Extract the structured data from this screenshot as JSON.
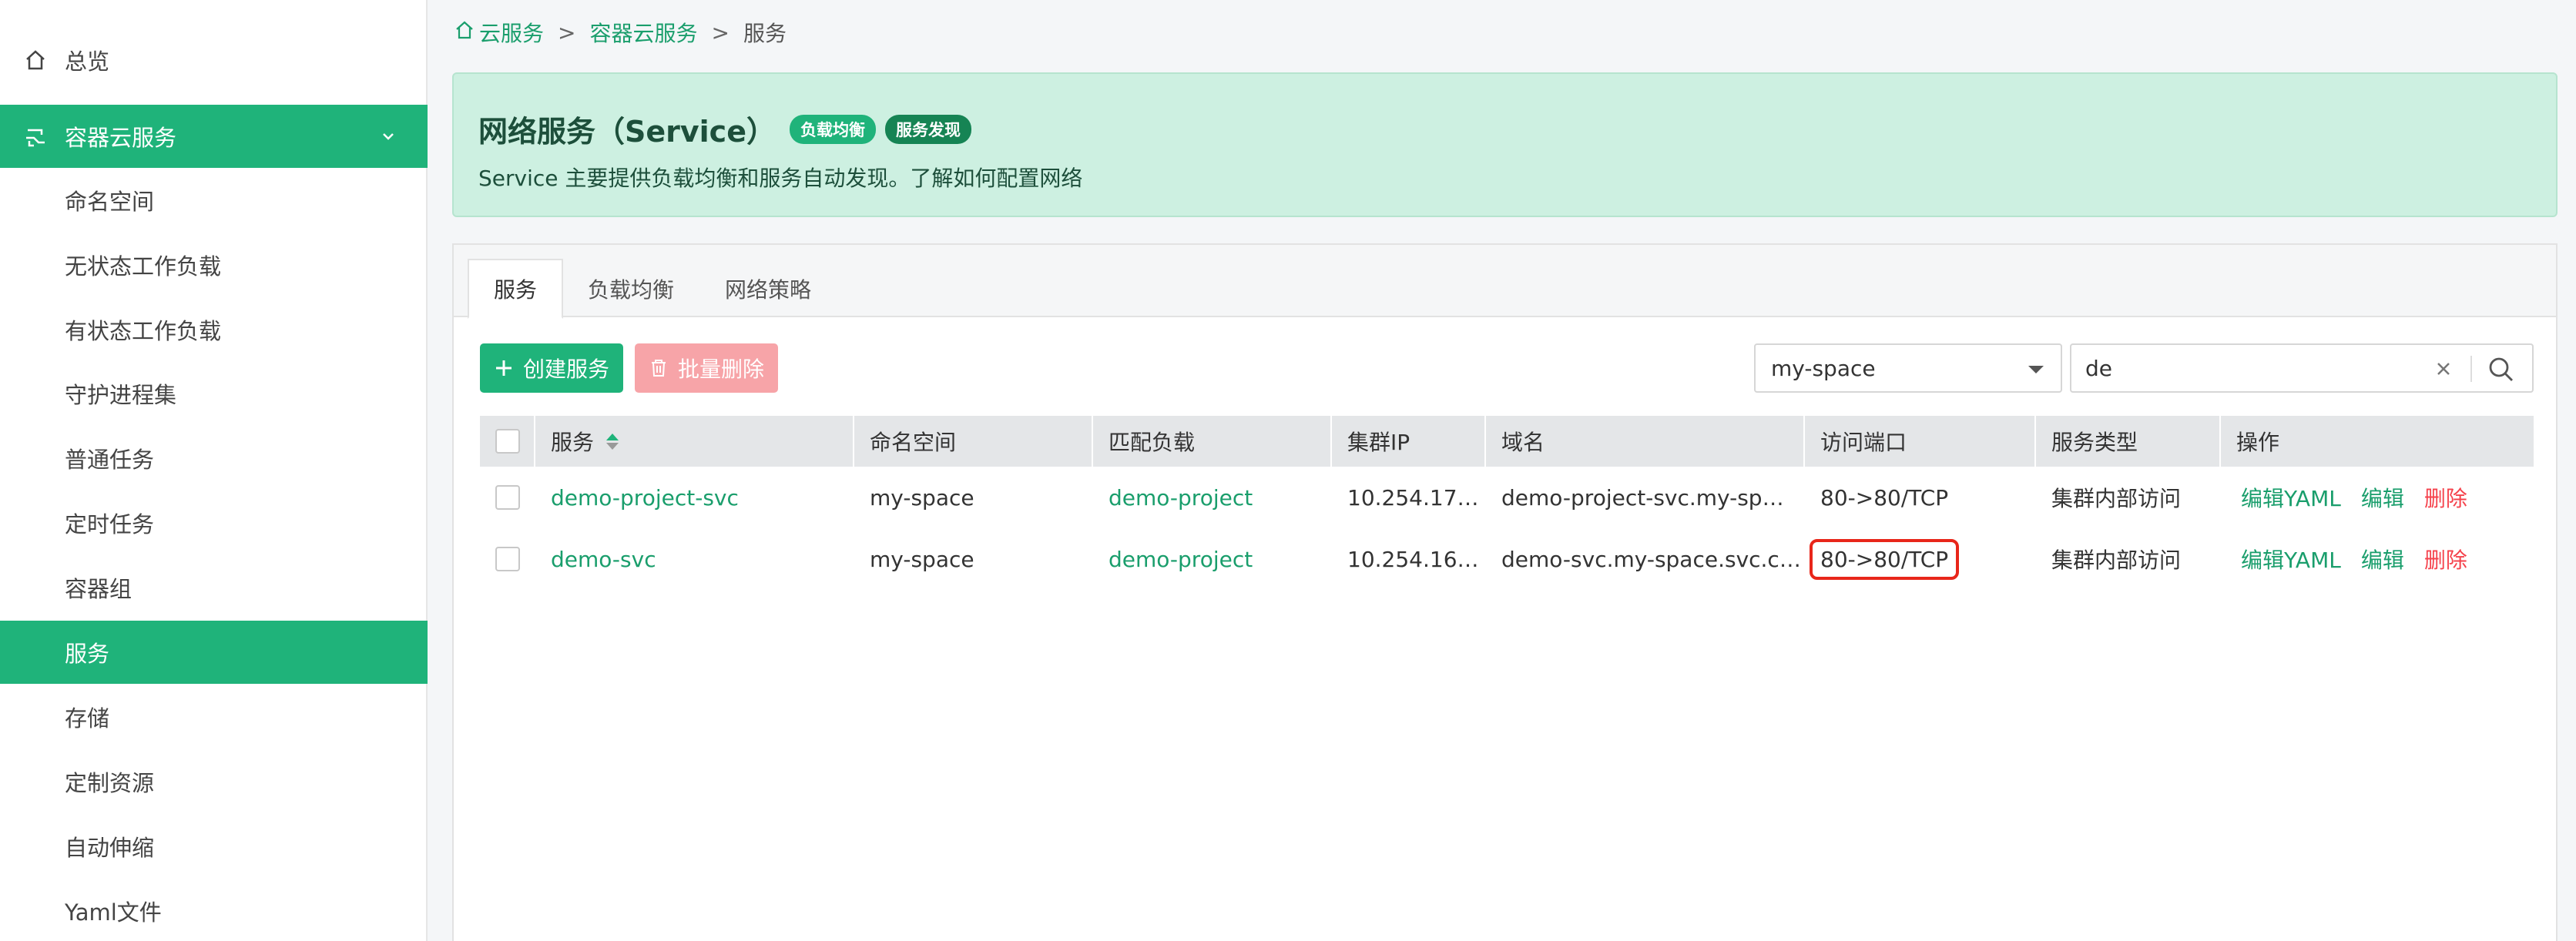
{
  "sidebar": {
    "overview": "总览",
    "group": "容器云服务",
    "items": [
      "命名空间",
      "无状态工作负载",
      "有状态工作负载",
      "守护进程集",
      "普通任务",
      "定时任务",
      "容器组",
      "服务",
      "存储",
      "定制资源",
      "自动伸缩",
      "Yaml文件"
    ],
    "active": "服务"
  },
  "breadcrumb": {
    "home": "云服务",
    "sep1": ">",
    "group": "容器云服务",
    "sep2": ">",
    "current": "服务"
  },
  "banner": {
    "title": "网络服务（Service）",
    "tag1": "负载均衡",
    "tag2": "服务发现",
    "desc": "Service 主要提供负载均衡和服务自动发现。了解如何配置网络"
  },
  "tabs": [
    "服务",
    "负载均衡",
    "网络策略"
  ],
  "toolbar": {
    "create": "创建服务",
    "batch_delete": "批量删除"
  },
  "filter": {
    "namespace": "my-space",
    "search_value": "de"
  },
  "table": {
    "headers": [
      "服务",
      "命名空间",
      "匹配负载",
      "集群IP",
      "域名",
      "访问端口",
      "服务类型",
      "操作"
    ],
    "rows": [
      {
        "name": "demo-project-svc",
        "namespace": "my-space",
        "workload": "demo-project",
        "ip": "10.254.17…",
        "domain": "demo-project-svc.my-sp…",
        "port": "80->80/TCP",
        "type": "集群内部访问",
        "a1": "编辑YAML",
        "a2": "编辑",
        "a3": "删除"
      },
      {
        "name": "demo-svc",
        "namespace": "my-space",
        "workload": "demo-project",
        "ip": "10.254.16…",
        "domain": "demo-svc.my-space.svc.c…",
        "port": "80->80/TCP",
        "type": "集群内部访问",
        "a1": "编辑YAML",
        "a2": "编辑",
        "a3": "删除"
      }
    ]
  },
  "colors": {
    "primary": "#1fb37a",
    "banner_bg": "#cdf0e1",
    "danger": "#f5424c",
    "highlight": "#e8261a"
  }
}
